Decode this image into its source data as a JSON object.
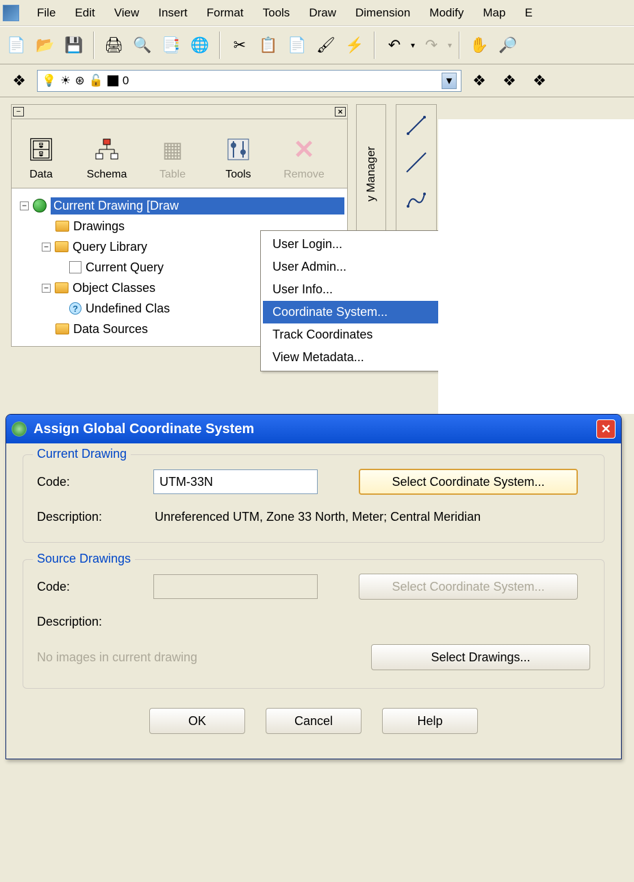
{
  "menubar": {
    "items": [
      "File",
      "Edit",
      "View",
      "Insert",
      "Format",
      "Tools",
      "Draw",
      "Dimension",
      "Modify",
      "Map",
      "E"
    ]
  },
  "layer": {
    "name": "0"
  },
  "panel": {
    "tools": [
      {
        "label": "Data",
        "disabled": false
      },
      {
        "label": "Schema",
        "disabled": false
      },
      {
        "label": "Table",
        "disabled": true
      },
      {
        "label": "Tools",
        "disabled": false
      },
      {
        "label": "Remove",
        "disabled": true
      }
    ]
  },
  "tree": {
    "current": "Current Drawing [Draw",
    "items": [
      "Drawings",
      "Query Library",
      "Current Query",
      "Object Classes",
      "Undefined Clas",
      "Data Sources"
    ]
  },
  "vertical_tab": "y Manager",
  "context_menu": {
    "items": [
      "User Login...",
      "User Admin...",
      "User Info...",
      "Coordinate System...",
      "Track Coordinates",
      "View Metadata..."
    ],
    "highlighted_index": 3
  },
  "dialog": {
    "title": "Assign Global Coordinate System",
    "group1": {
      "legend": "Current Drawing",
      "code_label": "Code:",
      "code_value": "UTM-33N",
      "select_btn": "Select Coordinate System...",
      "desc_label": "Description:",
      "desc_value": "Unreferenced UTM, Zone 33 North, Meter; Central Meridian"
    },
    "group2": {
      "legend": "Source Drawings",
      "code_label": "Code:",
      "code_value": "",
      "select_btn": "Select Coordinate System...",
      "desc_label": "Description:",
      "note": "No images in current drawing",
      "drawings_btn": "Select Drawings..."
    },
    "buttons": {
      "ok": "OK",
      "cancel": "Cancel",
      "help": "Help"
    }
  }
}
